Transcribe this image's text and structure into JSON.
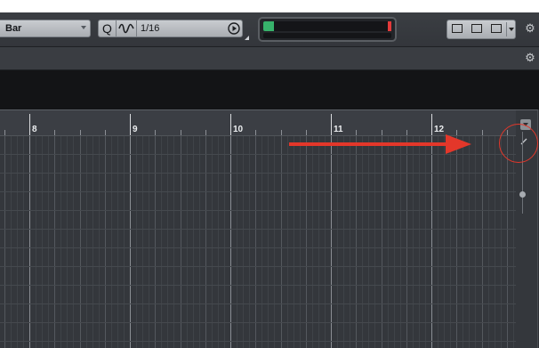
{
  "toolbar": {
    "ruler_format": "Bar",
    "quantize_icon_glyph": "Q",
    "quantize_value": "1/16",
    "settings_glyph": "⚙"
  },
  "row2": {
    "settings_glyph": "⚙"
  },
  "ruler": {
    "bar_numbers": [
      "8",
      "9",
      "10",
      "11",
      "12"
    ]
  },
  "colors": {
    "accent_meter": "#37b26b",
    "clip_indicator": "#e53a3a",
    "annotation": "#e3372a"
  },
  "icons": [
    "quantize-icon",
    "iterative-quantize-icon",
    "play-icon",
    "layout-left-icon",
    "layout-bottom-icon",
    "layout-right-icon",
    "gear-icon",
    "pencil-icon",
    "chevron-down-icon"
  ]
}
